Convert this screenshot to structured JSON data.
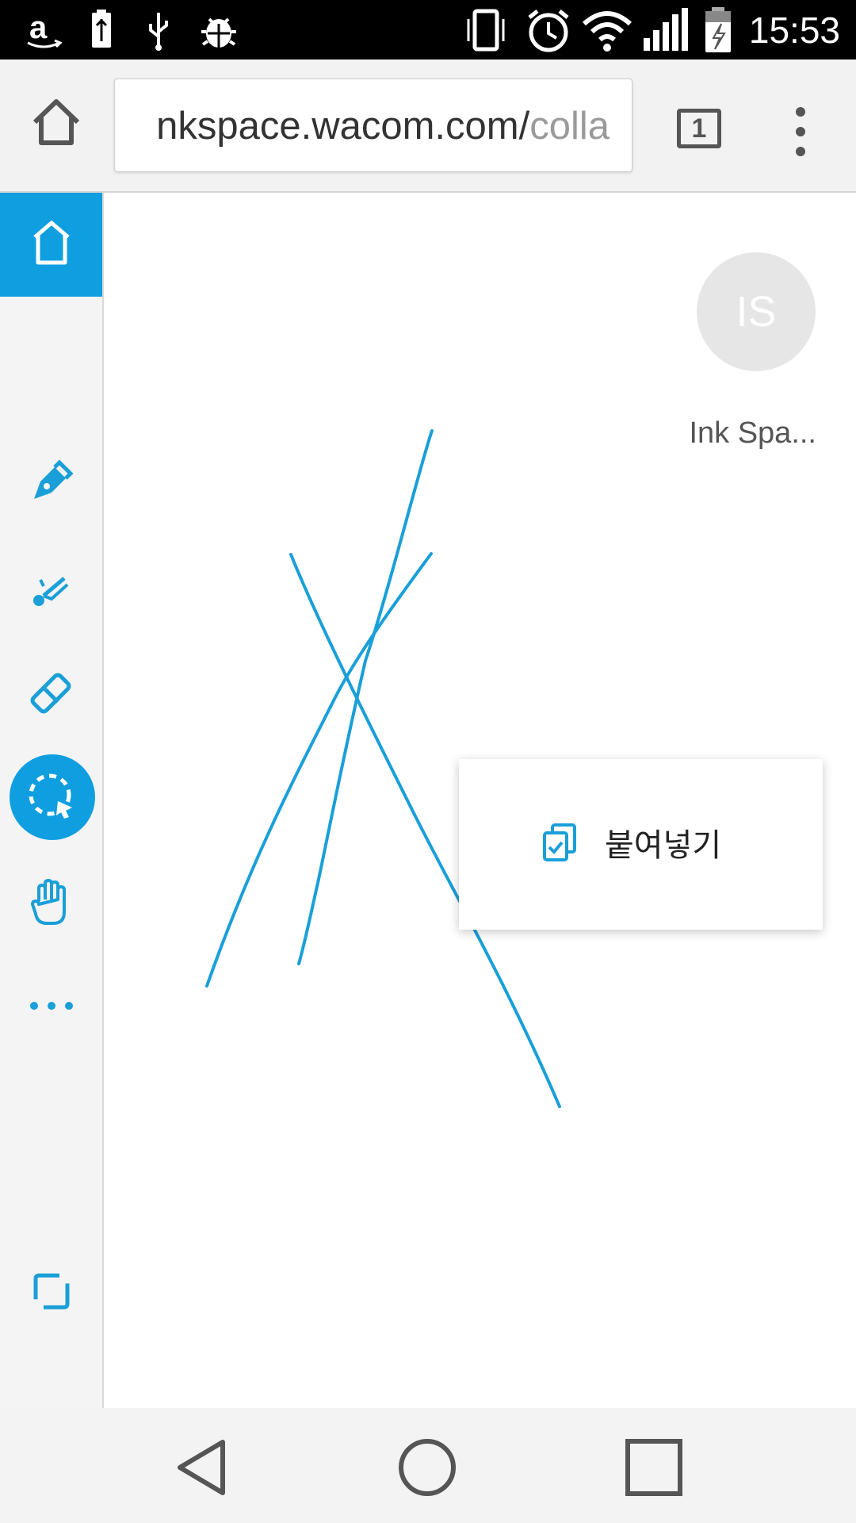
{
  "status_bar": {
    "time": "15:53",
    "left_icons": [
      "amazon-icon",
      "battery-usb-icon",
      "usb-icon",
      "debug-bug-icon"
    ],
    "right_icons": [
      "vibrate-icon",
      "alarm-icon",
      "wifi-icon",
      "signal-icon",
      "battery-charging-icon"
    ]
  },
  "browser": {
    "url_main": "nkspace.wacom.com/",
    "url_dim": "colla",
    "tab_count": "1"
  },
  "rail": {
    "tools": [
      "home-icon",
      "pen-icon",
      "brush-icon",
      "eraser-icon",
      "select-icon",
      "hand-icon",
      "more-icon",
      "fullscreen-icon"
    ],
    "active_tool": "select",
    "accent_color": "#0f9ee0"
  },
  "canvas": {
    "ink_color": "#1a9fd8"
  },
  "user": {
    "initials": "IS",
    "name": "Ink Spa..."
  },
  "context_menu": {
    "paste_label": "붙여넣기"
  },
  "navbar": {
    "buttons": [
      "back-icon",
      "home-circle-icon",
      "recents-icon"
    ]
  }
}
